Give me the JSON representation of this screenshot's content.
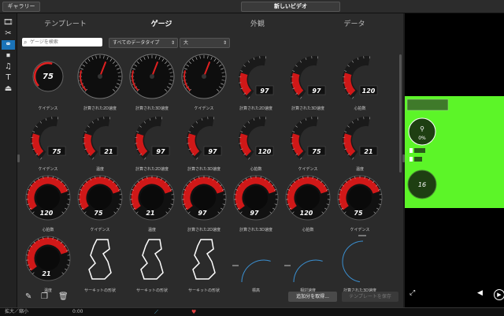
{
  "header": {
    "gallery_label": "ギャラリー",
    "project_title": "新しいビデオ"
  },
  "toolbar": {
    "items": [
      {
        "icon": "film-icon",
        "glyph": "🎞"
      },
      {
        "icon": "scissors-icon",
        "glyph": "✂"
      },
      {
        "icon": "gauge-link-icon",
        "glyph": "⚭"
      },
      {
        "icon": "clip-icon",
        "glyph": "⏹"
      },
      {
        "icon": "music-icon",
        "glyph": "♫"
      },
      {
        "icon": "text-icon",
        "glyph": "T"
      },
      {
        "icon": "export-icon",
        "glyph": "⏏"
      }
    ]
  },
  "tabs": [
    "テンプレート",
    "ゲージ",
    "外観",
    "データ"
  ],
  "filters": {
    "search_placeholder": "ゲージを検索",
    "data_type": "すべてのデータタイプ",
    "size": "大"
  },
  "gauges": [
    {
      "label": "ケイデンス",
      "value": "75",
      "type": "round-small"
    },
    {
      "label": "計算された2D速度",
      "value": "",
      "type": "dial"
    },
    {
      "label": "計算された3D速度",
      "value": "",
      "type": "dial"
    },
    {
      "label": "ケイデンス",
      "value": "",
      "type": "dial"
    },
    {
      "label": "計算された2D速度",
      "value": "97",
      "type": "arc"
    },
    {
      "label": "計算された3D速度",
      "value": "97",
      "type": "arc"
    },
    {
      "label": "心拍数",
      "value": "120",
      "type": "arc"
    },
    {
      "label": "ケイデンス",
      "value": "75",
      "type": "arc"
    },
    {
      "label": "温度",
      "value": "21",
      "type": "arc"
    },
    {
      "label": "計算された2D速度",
      "value": "97",
      "type": "arc"
    },
    {
      "label": "計算された3D速度",
      "value": "97",
      "type": "arc"
    },
    {
      "label": "心拍数",
      "value": "120",
      "type": "arc"
    },
    {
      "label": "ケイデンス",
      "value": "75",
      "type": "arc"
    },
    {
      "label": "温度",
      "value": "21",
      "type": "arc"
    },
    {
      "label": "心拍数",
      "value": "120",
      "type": "round"
    },
    {
      "label": "ケイデンス",
      "value": "75",
      "type": "round"
    },
    {
      "label": "温度",
      "value": "21",
      "type": "round"
    },
    {
      "label": "計算された2D速度",
      "value": "97",
      "type": "round"
    },
    {
      "label": "計算された3D速度",
      "value": "97",
      "type": "round"
    },
    {
      "label": "心拍数",
      "value": "120",
      "type": "round"
    },
    {
      "label": "ケイデンス",
      "value": "75",
      "type": "round"
    },
    {
      "label": "温度",
      "value": "21",
      "type": "round"
    },
    {
      "label": "サーキットの形状",
      "value": "",
      "type": "track"
    },
    {
      "label": "サーキットの形状",
      "value": "",
      "type": "track"
    },
    {
      "label": "サーキットの形状",
      "value": "",
      "type": "track"
    },
    {
      "label": "標高",
      "value": "",
      "type": "line-arc"
    },
    {
      "label": "相対速度",
      "value": "",
      "type": "line-arc"
    },
    {
      "label": "計算された3D速度",
      "value": "",
      "type": "line-circle"
    }
  ],
  "bottom": {
    "get_addons": "追加分を取得...",
    "save_template": "テンプレートを保存"
  },
  "preview": {
    "percent": "0%",
    "value": "16"
  },
  "timeline": {
    "zoom_label": "拡大／縮小",
    "time": "0:00"
  }
}
